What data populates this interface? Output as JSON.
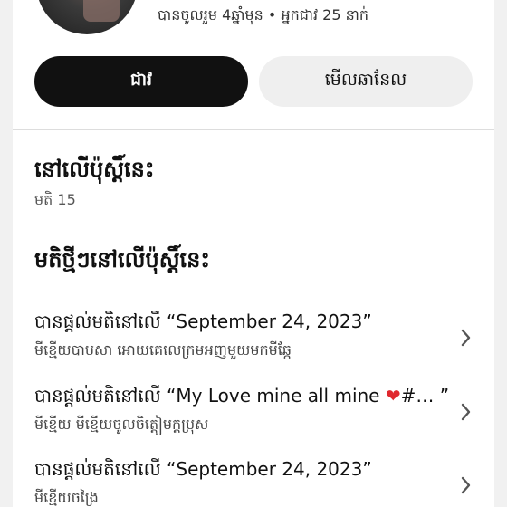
{
  "profile": {
    "meta": "បានចូលរួម 4ឆ្នាំមុន • អ្នកជាវ 25 នាក់"
  },
  "actions": {
    "subscribe_label": "ជាវ",
    "view_channel_label": "មើលឆានែល"
  },
  "on_post": {
    "title": "នៅលើប៉ុស្តិ៍នេះ",
    "comments_count": "មតិ 15"
  },
  "new_comments": {
    "title": "មតិថ្មីៗនៅលើប៉ុស្តិ៍នេះ",
    "items": [
      {
        "prefix": "បានផ្ដល់មតិនៅលើ ",
        "post": "“September 24, 2023”",
        "comment": "មីខ្មើយបាបសា អោយគេលេក្រមអញមួយមកមីឆ្កែ"
      },
      {
        "prefix": "បានផ្ដល់មតិនៅលើ ",
        "post_before_heart": "“My Love mine all mine ",
        "heart": "❤",
        "post_after_heart": "#… ”",
        "comment": "មីខ្មើយ មីខ្មើយចូលចិត្ដៀមក្ដប្រុស"
      },
      {
        "prefix": "បានផ្ដល់មតិនៅលើ ",
        "post": "“September 24, 2023”",
        "comment": "មីខ្មើយចង្រៃ"
      }
    ]
  },
  "colors": {
    "primary_button": "#111111",
    "secondary_button": "#efefef",
    "heart": "#e0282e"
  }
}
